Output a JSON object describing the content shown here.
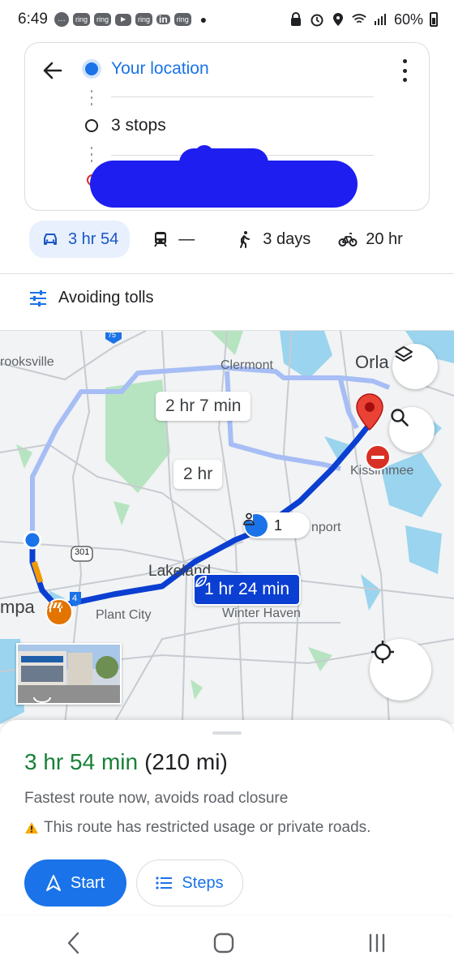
{
  "status_bar": {
    "time": "6:49",
    "notifications": [
      "chat-icon",
      "ring",
      "ring",
      "youtube-icon",
      "ring",
      "in",
      "ring"
    ],
    "battery": "60%"
  },
  "directions": {
    "origin": "Your location",
    "stops": "3 stops"
  },
  "modes": [
    {
      "icon": "car-icon",
      "label": "3 hr 54",
      "active": true
    },
    {
      "icon": "transit-icon",
      "label": "—"
    },
    {
      "icon": "walk-icon",
      "label": "3 days"
    },
    {
      "icon": "bike-icon",
      "label": "20 hr"
    }
  ],
  "options": {
    "avoid_label": "Avoiding tolls"
  },
  "map": {
    "labels": {
      "brooksville": "rooksville",
      "clermont": "Clermont",
      "orlando": "Orla",
      "kissimmee": "Kissimmee",
      "davenport": "nport",
      "lakeland": "Lakeland",
      "plant_city": "Plant City",
      "winter_haven": "Winter Haven",
      "tampa": "mpa",
      "hwy_301": "301",
      "hwy_4": "4",
      "hwy_75": "75"
    },
    "route_times": {
      "alt1": "2 hr 7 min",
      "alt2": "2 hr",
      "main": "1 hr 24 min"
    },
    "traffic_reports": "1"
  },
  "sheet": {
    "duration": "3 hr 54 min",
    "distance": "(210 mi)",
    "description": "Fastest route now, avoids road closure",
    "warning": "This route has restricted usage or private roads.",
    "start_label": "Start",
    "steps_label": "Steps"
  },
  "colors": {
    "accent": "#1a73e8",
    "route_main": "#0b3fd1",
    "route_alt": "#a6bdf5",
    "duration_green": "#188038",
    "water": "#9ad4ee",
    "park": "#b7e4c0"
  }
}
